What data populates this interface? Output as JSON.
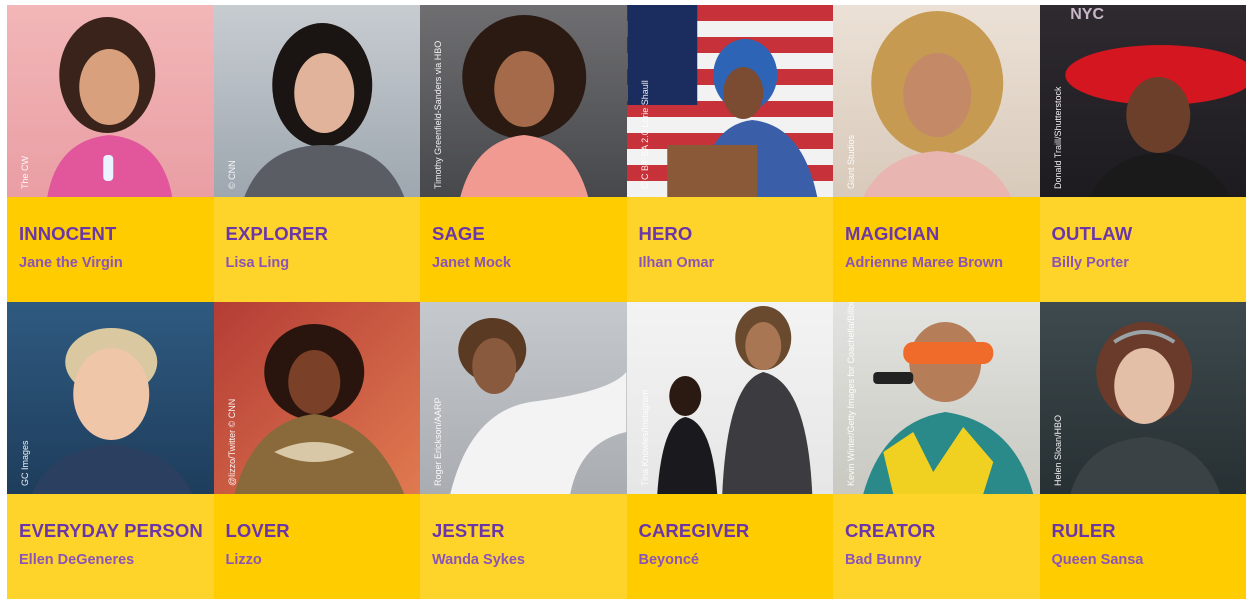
{
  "colors": {
    "label_bg_light": "#ffd42a",
    "label_bg_dark": "#ffcc00",
    "archetype_text": "#6b36a8",
    "person_text": "#8a54b8"
  },
  "cards": [
    {
      "archetype": "INNOCENT",
      "person": "Jane the Virgin",
      "credit": "The CW"
    },
    {
      "archetype": "EXPLORER",
      "person": "Lisa Ling",
      "credit": "© CNN"
    },
    {
      "archetype": "SAGE",
      "person": "Janet Mock",
      "credit": "Timothy Greenfield-Sanders via HBO"
    },
    {
      "archetype": "HERO",
      "person": "Ilhan Omar",
      "credit": "C C BY-SA 2.0 Lorie Shaull"
    },
    {
      "archetype": "MAGICIAN",
      "person": "Adrienne Maree Brown",
      "credit": "Giant Studios"
    },
    {
      "archetype": "OUTLAW",
      "person": "Billy Porter",
      "credit": "Donald Traill/Shutterstock"
    },
    {
      "archetype": "EVERYDAY PERSON",
      "person": "Ellen DeGeneres",
      "credit": "GC Images"
    },
    {
      "archetype": "LOVER",
      "person": "Lizzo",
      "credit": "@lizzo/Twitter © CNN"
    },
    {
      "archetype": "JESTER",
      "person": "Wanda Sykes",
      "credit": "Roger Erickson/AARP"
    },
    {
      "archetype": "CAREGIVER",
      "person": "Beyoncé",
      "credit": "Tina Knowles/Instagram"
    },
    {
      "archetype": "CREATOR",
      "person": "Bad Bunny",
      "credit": "Kevin Winter/Getty Images for Coachella/Billboard"
    },
    {
      "archetype": "RULER",
      "person": "Queen Sansa",
      "credit": "Helen Sloan/HBO"
    }
  ]
}
